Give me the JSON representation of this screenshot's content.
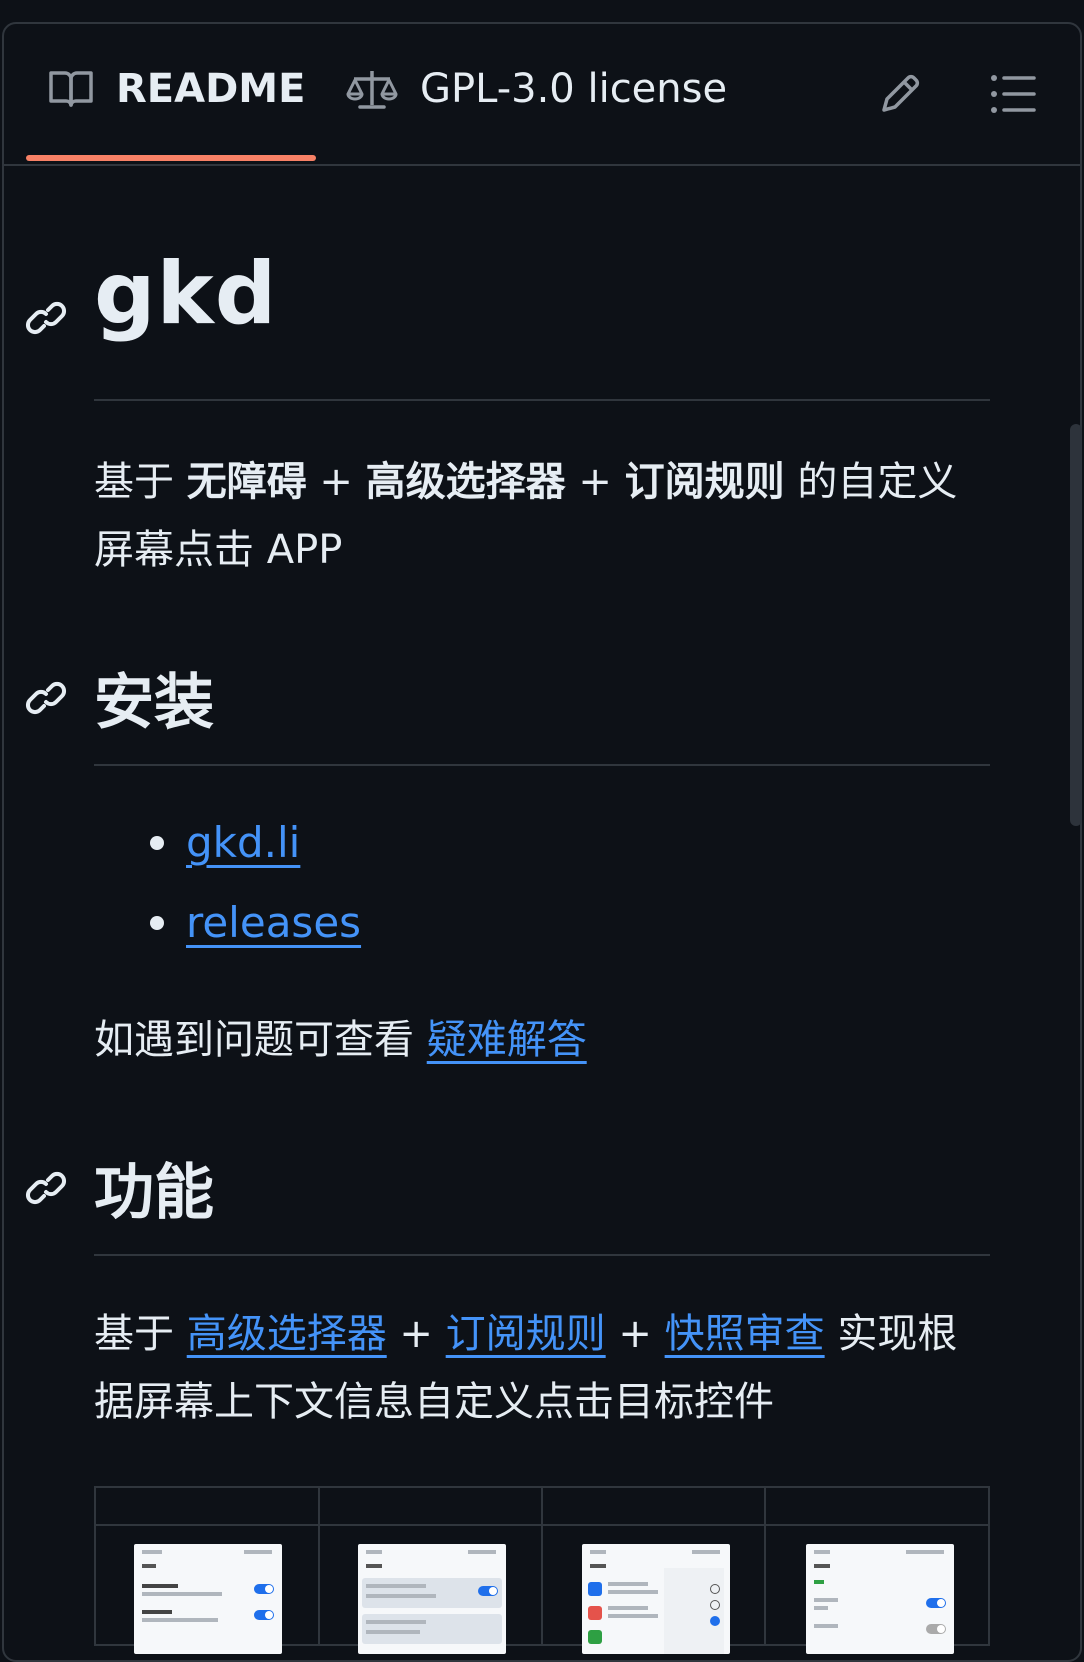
{
  "tabs": {
    "readme": "README",
    "license": "GPL-3.0 license"
  },
  "title": "gkd",
  "intro": {
    "part1": "基于 ",
    "bold1": "无障碍",
    "plus1": " + ",
    "bold2": "高级选择器",
    "plus2": " + ",
    "bold3": "订阅规则",
    "part2": " 的自定义屏幕点击 APP"
  },
  "install": {
    "heading": "安装",
    "links": [
      "gkd.li",
      "releases"
    ],
    "faq_text": "如遇到问题可查看 ",
    "faq_link": "疑难解答"
  },
  "features": {
    "heading": "功能",
    "part1": "基于 ",
    "link1": "高级选择器",
    "plus1": " + ",
    "link2": "订阅规则",
    "plus2": " + ",
    "link3": "快照审查",
    "part2": " 实现根据屏幕上下文信息自定义点击目标控件"
  },
  "icons": {
    "readme": "book-icon",
    "license": "scale-icon",
    "edit": "pencil-icon",
    "toc": "list-icon",
    "anchor": "link-icon"
  },
  "colors": {
    "accent_underline": "#f78166",
    "link": "#4493f8",
    "background": "#0d1117"
  }
}
